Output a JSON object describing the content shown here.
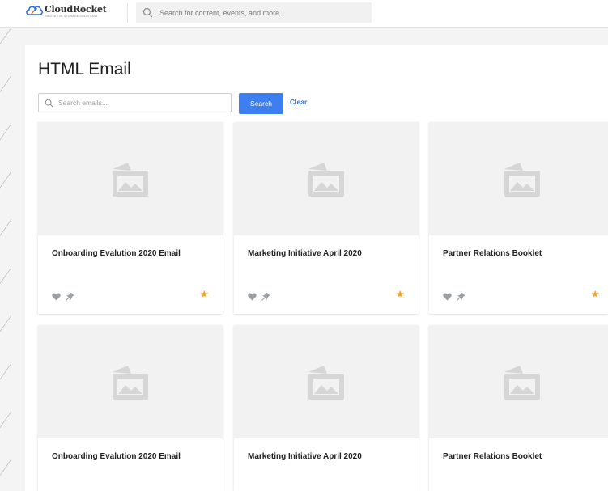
{
  "header": {
    "logo_name": "CloudRocket",
    "logo_tagline": "INNOVATIVE STORAGE SOLUTIONS",
    "search_placeholder": "Search for content, events, and more..."
  },
  "page": {
    "title": "HTML Email",
    "search_placeholder": "Search emails...",
    "search_button": "Search",
    "clear_link": "Clear"
  },
  "colors": {
    "accent": "#3d7ef0",
    "star": "#f2a531",
    "icon_gray": "#9aa0a6"
  },
  "cards": [
    {
      "title": "Onboarding Evalution 2020 Email",
      "starred": true
    },
    {
      "title": "Marketing Initiative April 2020",
      "starred": true
    },
    {
      "title": "Partner Relations Booklet",
      "starred": true
    },
    {
      "title": "Onboarding Evalution 2020 Email"
    },
    {
      "title": "Marketing Initiative April 2020"
    },
    {
      "title": "Partner Relations Booklet"
    }
  ],
  "icons": {
    "thumbnail": "image-placeholder-icon",
    "favorite": "heart-icon",
    "pin": "pin-icon",
    "star": "star-icon"
  }
}
